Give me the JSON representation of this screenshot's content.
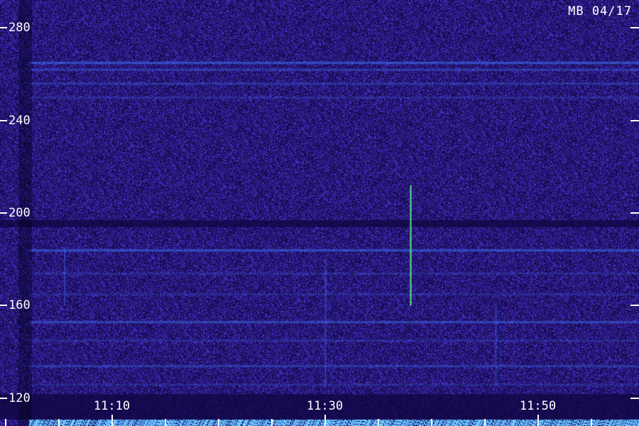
{
  "chart_data": {
    "type": "heatmap",
    "title": "MB 04/17",
    "y_ticks": [
      280,
      240,
      200,
      160,
      120
    ],
    "ylim": [
      108,
      292
    ],
    "x_major_ticks": [
      "11:10",
      "11:30",
      "11:50"
    ],
    "x_major_minutes": [
      670,
      690,
      710
    ],
    "x_minor_step_minutes": 5,
    "xlim_minutes": [
      659.5,
      719.5
    ],
    "colors": {
      "background": "#24147a",
      "noise_low": "#0f0640",
      "noise_high": "#5a3cf0",
      "band": "#3c78ff",
      "bright": "#7ae0ff",
      "accent_green": "#60ff90",
      "text": "#ffffff"
    },
    "horizontal_bands": [
      {
        "y": 265,
        "strength": 0.9
      },
      {
        "y": 262,
        "strength": 0.6
      },
      {
        "y": 256,
        "strength": 0.5
      },
      {
        "y": 250,
        "strength": 0.35
      },
      {
        "y": 184,
        "strength": 0.85
      },
      {
        "y": 174,
        "strength": 0.35
      },
      {
        "y": 165,
        "strength": 0.3
      },
      {
        "y": 153,
        "strength": 0.75
      },
      {
        "y": 145,
        "strength": 0.35
      },
      {
        "y": 134,
        "strength": 0.55
      },
      {
        "y": 126,
        "strength": 0.3
      }
    ],
    "dark_bands": [
      {
        "y_top": 197,
        "y_bottom": 194
      },
      {
        "y_top": 122,
        "y_bottom": 111
      }
    ],
    "vertical_features": [
      {
        "x": 690,
        "y_top": 180,
        "y_bottom": 125,
        "strength": 0.4
      },
      {
        "x": 698,
        "y_top": 212,
        "y_bottom": 160,
        "strength": 0.9
      },
      {
        "x": 706,
        "y_top": 160,
        "y_bottom": 125,
        "strength": 0.35
      },
      {
        "x": 665.5,
        "y_top": 185,
        "y_bottom": 160,
        "strength": 0.4
      }
    ],
    "bright_floor_below": 111
  }
}
